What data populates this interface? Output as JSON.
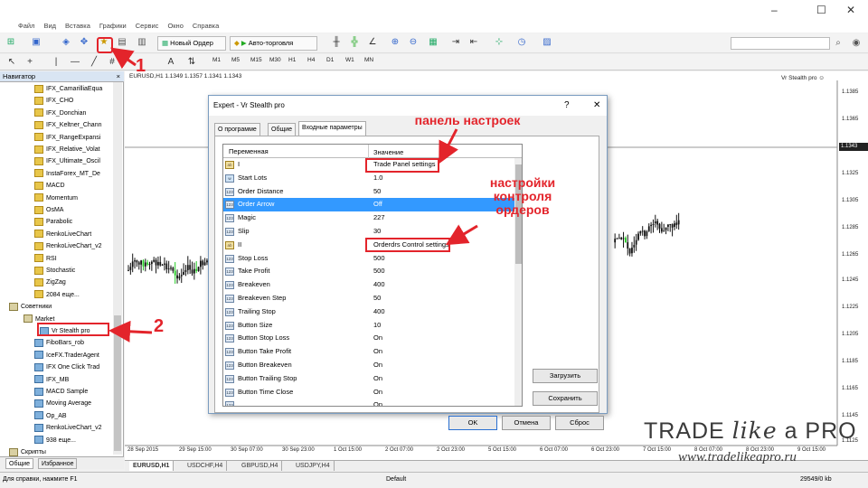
{
  "window": {
    "minimize": "–",
    "maximize": "☐",
    "close": "✕"
  },
  "menu": [
    "Файл",
    "Вид",
    "Вставка",
    "Графики",
    "Сервис",
    "Окно",
    "Справка"
  ],
  "toolbar": {
    "new_order": "Новый Ордер",
    "autotrading": "Авто-торговля",
    "timeframes": [
      "M1",
      "M5",
      "M15",
      "M30",
      "H1",
      "H4",
      "D1",
      "W1",
      "MN"
    ]
  },
  "navigator": {
    "title": "Навигатор",
    "close": "×",
    "indicators": [
      "IFX_CamarilliaEqua",
      "IFX_CHO",
      "IFX_Donchian",
      "IFX_Keltner_Chann",
      "IFX_RangeExpansi",
      "IFX_Relative_Volat",
      "IFX_Ultimate_Oscil",
      "InstaForex_MT_De",
      "MACD",
      "Momentum",
      "OsMA",
      "Parabolic",
      "RenkoLiveChart",
      "RenkoLiveChart_v2",
      "RSI",
      "Stochastic",
      "ZigZag",
      "2084 еще..."
    ],
    "advisors_label": "Советники",
    "market_label": "Market",
    "market_item": "Vr Stealth pro",
    "experts": [
      "FiboBars_rob",
      "IceFX.TraderAgent",
      "IFX One Click Trad",
      "IFX_MB",
      "MACD Sample",
      "Moving Average",
      "Op_AB",
      "RenkoLiveChart_v2",
      "938 еще..."
    ],
    "scripts_label": "Скрипты",
    "tabs": [
      "Общие",
      "Избранное"
    ]
  },
  "chart": {
    "title": "EURUSD,H1  1.1349 1.1357 1.1341 1.1343",
    "ea_name": "Vr Stealth pro ☺",
    "current_price": "1.1343",
    "price_ticks": [
      "1.1385",
      "1.1365",
      "1.1343",
      "1.1325",
      "1.1305",
      "1.1285",
      "1.1265",
      "1.1245",
      "1.1225",
      "1.1205",
      "1.1185",
      "1.1165",
      "1.1145",
      "1.1125"
    ],
    "time_ticks": [
      "28 Sep 2015",
      "29 Sep 15:00",
      "30 Sep 07:00",
      "30 Sep 23:00",
      "1 Oct 15:00",
      "2 Oct 07:00",
      "2 Oct 23:00",
      "5 Oct 15:00",
      "6 Oct 07:00",
      "6 Oct 23:00",
      "7 Oct 15:00",
      "8 Oct 07:00",
      "8 Oct 23:00",
      "9 Oct 15:00"
    ],
    "tabs": [
      "EURUSD,H1",
      "USDCHF,H4",
      "GBPUSD,H4",
      "USDJPY,H4"
    ]
  },
  "status": {
    "help": "Для справки, нажмите F1",
    "profile": "Default",
    "traffic": "29549/0 kb"
  },
  "dialog": {
    "title": "Expert - Vr Stealth pro",
    "help": "?",
    "close": "✕",
    "tabs": [
      "О программе",
      "Общие",
      "Входные параметры"
    ],
    "col_variable": "Переменная",
    "col_value": "Значение",
    "rows": [
      {
        "icon": "ab",
        "name": "I",
        "value": "Trade Panel settings"
      },
      {
        "icon": "w",
        "name": "Start Lots",
        "value": "1.0"
      },
      {
        "icon": "123",
        "name": "Order Distance",
        "value": "50"
      },
      {
        "icon": "123",
        "name": "Order Arrow",
        "value": "Off"
      },
      {
        "icon": "123",
        "name": "Magic",
        "value": "227"
      },
      {
        "icon": "123",
        "name": "Slip",
        "value": "30"
      },
      {
        "icon": "ab",
        "name": "II",
        "value": "Orderdrs Control settings"
      },
      {
        "icon": "123",
        "name": "Stop Loss",
        "value": "500"
      },
      {
        "icon": "123",
        "name": "Take Profit",
        "value": "500"
      },
      {
        "icon": "123",
        "name": "Breakeven",
        "value": "400"
      },
      {
        "icon": "123",
        "name": "Breakeven Step",
        "value": "50"
      },
      {
        "icon": "123",
        "name": "Trailing Stop",
        "value": "400"
      },
      {
        "icon": "123",
        "name": "Button Size",
        "value": "10"
      },
      {
        "icon": "123",
        "name": "Button Stop Loss",
        "value": "On"
      },
      {
        "icon": "123",
        "name": "Button Take Profit",
        "value": "On"
      },
      {
        "icon": "123",
        "name": "Button Breakeven",
        "value": "On"
      },
      {
        "icon": "123",
        "name": "Button Trailing Stop",
        "value": "On"
      },
      {
        "icon": "123",
        "name": "Button Time Close",
        "value": "On"
      },
      {
        "icon": "123",
        "name": "",
        "value": "On"
      }
    ],
    "selected_row": 3,
    "load": "Загрузить",
    "save": "Сохранить",
    "ok": "OK",
    "cancel": "Отмена",
    "reset": "Сброс"
  },
  "annotations": {
    "panel_settings": "панель настроек",
    "orders_control": "настройки\nконтроля\nордеров",
    "marker_1": "1",
    "marker_2": "2"
  },
  "branding": {
    "logo_trade": "TRADE ",
    "logo_like": "like",
    "logo_a": " a ",
    "logo_pro": "PRO",
    "url": "www.tradelikeapro.ru"
  }
}
